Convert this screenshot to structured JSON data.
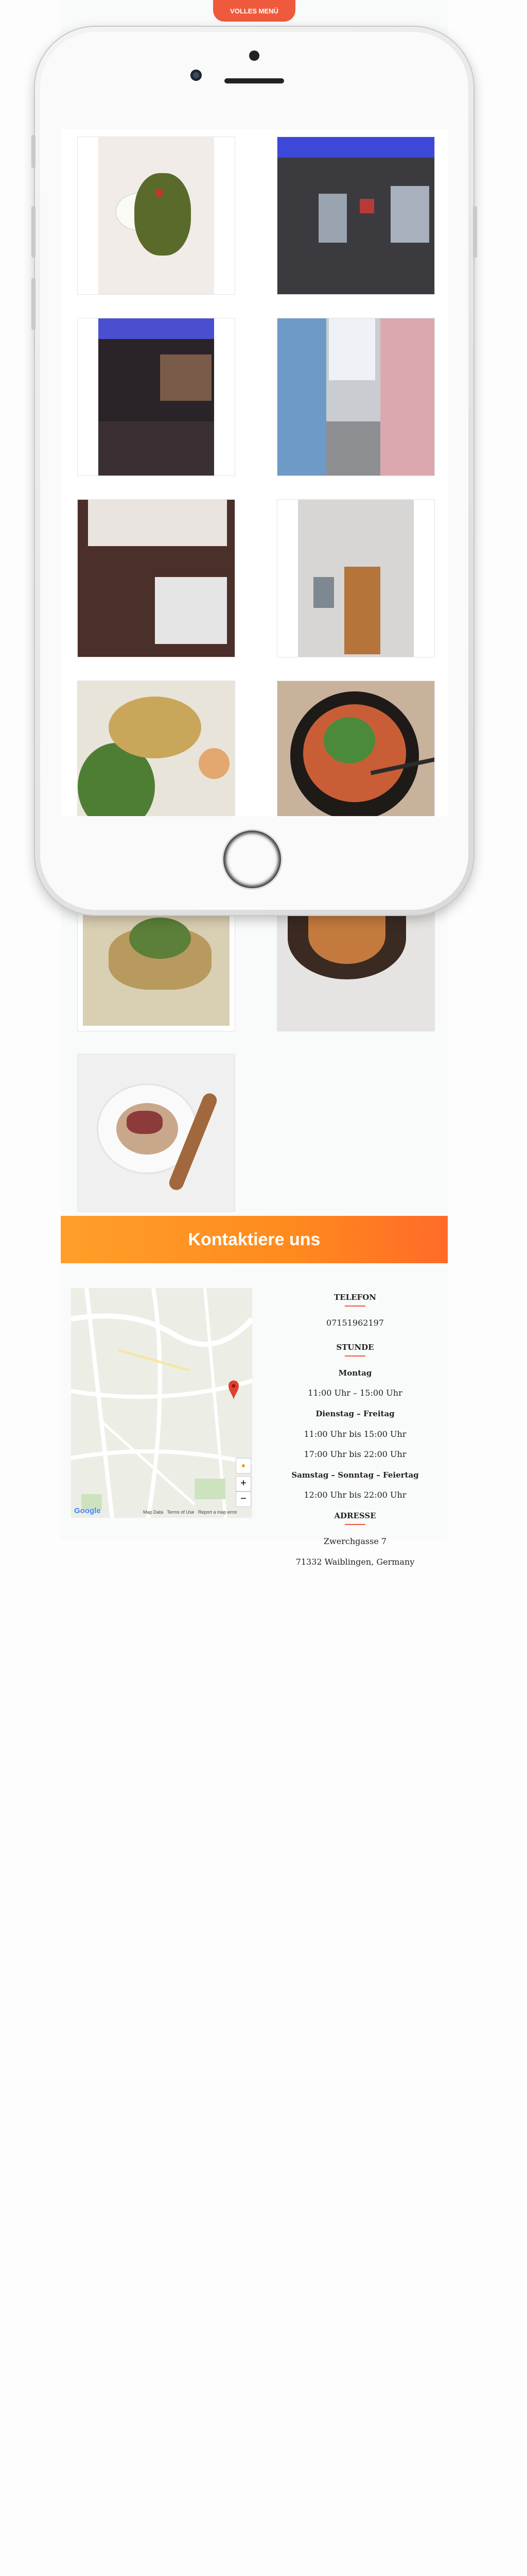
{
  "top_button": {
    "label": "VOLLES MENÜ"
  },
  "gallery": {
    "items": [
      {
        "alt": "Gericht mit Reis und Kräutern"
      },
      {
        "alt": "Restaurant Eingang mit blauer Beleuchtung"
      },
      {
        "alt": "Gastraum mit Bar"
      },
      {
        "alt": "Gasse Zwerchgasse"
      },
      {
        "alt": "Gastraum mit Tischen"
      },
      {
        "alt": "Restaurant Fassade"
      },
      {
        "alt": "Teller mit Salat und Omelett"
      },
      {
        "alt": "Schüssel mit Gemüse und Essstäbchen"
      },
      {
        "alt": "Salat auf Reispapier"
      },
      {
        "alt": "Schüssel mit Garnelen"
      },
      {
        "alt": "Pho Suppe mit Holzlöffel"
      }
    ]
  },
  "contact": {
    "heading": "Kontaktiere uns",
    "phone_label": "TELEFON",
    "phone": "07151962197",
    "hours_label": "STUNDE",
    "monday": "Montag",
    "monday_hours": "11:00 Uhr – 15:00 Uhr",
    "tue_fri": "Dienstag – Freitag",
    "tue_fri_hours_1": "11:00 Uhr bis 15:00 Uhr",
    "tue_fri_hours_2": "17:00 Uhr bis 22:00 Uhr",
    "weekend": "Samstag – Sonntag – Feiertag",
    "weekend_hours": "12:00 Uhr bis 22:00 Uhr",
    "address_label": "ADRESSE",
    "street": "Zwerchgasse 7",
    "city": "71332 Waiblingen, Germany"
  },
  "map": {
    "logo": "Google",
    "footer": "Map Data   Terms of Use   Report a map error",
    "zoom_in": "+",
    "zoom_out": "−"
  }
}
